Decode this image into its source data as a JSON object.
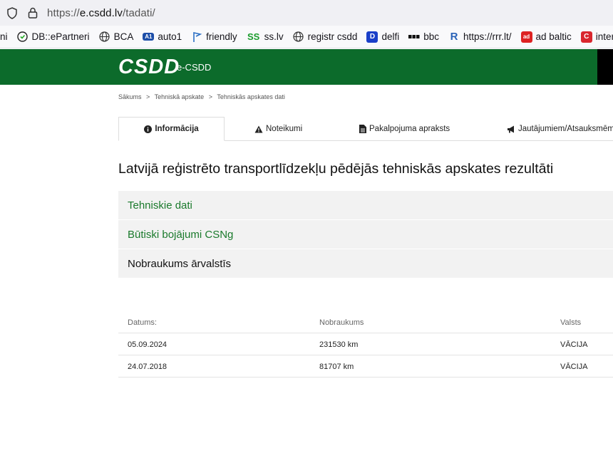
{
  "browser": {
    "url_prefix": "https://",
    "url_domain": "e.csdd.lv",
    "url_path": "/tadati/"
  },
  "bookmarks": [
    {
      "label": "ni",
      "icon": "none"
    },
    {
      "label": "DB::ePartneri",
      "icon": "db-icon"
    },
    {
      "label": "BCA",
      "icon": "globe-icon"
    },
    {
      "label": "auto1",
      "icon": "auto1-icon"
    },
    {
      "label": "friendly",
      "icon": "flag-icon"
    },
    {
      "label": "ss.lv",
      "icon": "ss-icon"
    },
    {
      "label": "registr csdd",
      "icon": "globe-icon"
    },
    {
      "label": "delfi",
      "icon": "delfi-icon"
    },
    {
      "label": "bbc",
      "icon": "bbc-icon"
    },
    {
      "label": "https://rrr.lt/",
      "icon": "rrr-icon"
    },
    {
      "label": "ad baltic",
      "icon": "adbaltic-icon"
    },
    {
      "label": "inter",
      "icon": "inter-icon"
    }
  ],
  "header": {
    "logo": "CSDD",
    "subtitle": "e-CSDD",
    "color": "#0c6b2b"
  },
  "breadcrumb": [
    "Sākums",
    ">",
    "Tehniskā apskate",
    ">",
    "Tehniskās apskates dati"
  ],
  "tabs": [
    {
      "label": "Informācija",
      "icon": "info-icon",
      "active": true
    },
    {
      "label": "Noteikumi",
      "icon": "warning-icon",
      "active": false
    },
    {
      "label": "Pakalpojuma apraksts",
      "icon": "document-icon",
      "active": false
    },
    {
      "label": "Jautājumiem/Atsauksmēm",
      "icon": "megaphone-icon",
      "active": false
    }
  ],
  "heading": "Latvijā reģistrēto transportlīdzekļu pēdējās tehniskās apskates rezultāti",
  "sections": [
    {
      "label": "Tehniskie dati"
    },
    {
      "label": "Būtiski bojājumi CSNg"
    },
    {
      "label": "Nobraukums ārvalstīs"
    }
  ],
  "table": {
    "headers": [
      "Datums:",
      "Nobraukums",
      "Valsts"
    ],
    "rows": [
      [
        "05.09.2024",
        "231530 km",
        "VĀCIJA"
      ],
      [
        "24.07.2018",
        "81707 km",
        "VĀCIJA"
      ]
    ]
  }
}
